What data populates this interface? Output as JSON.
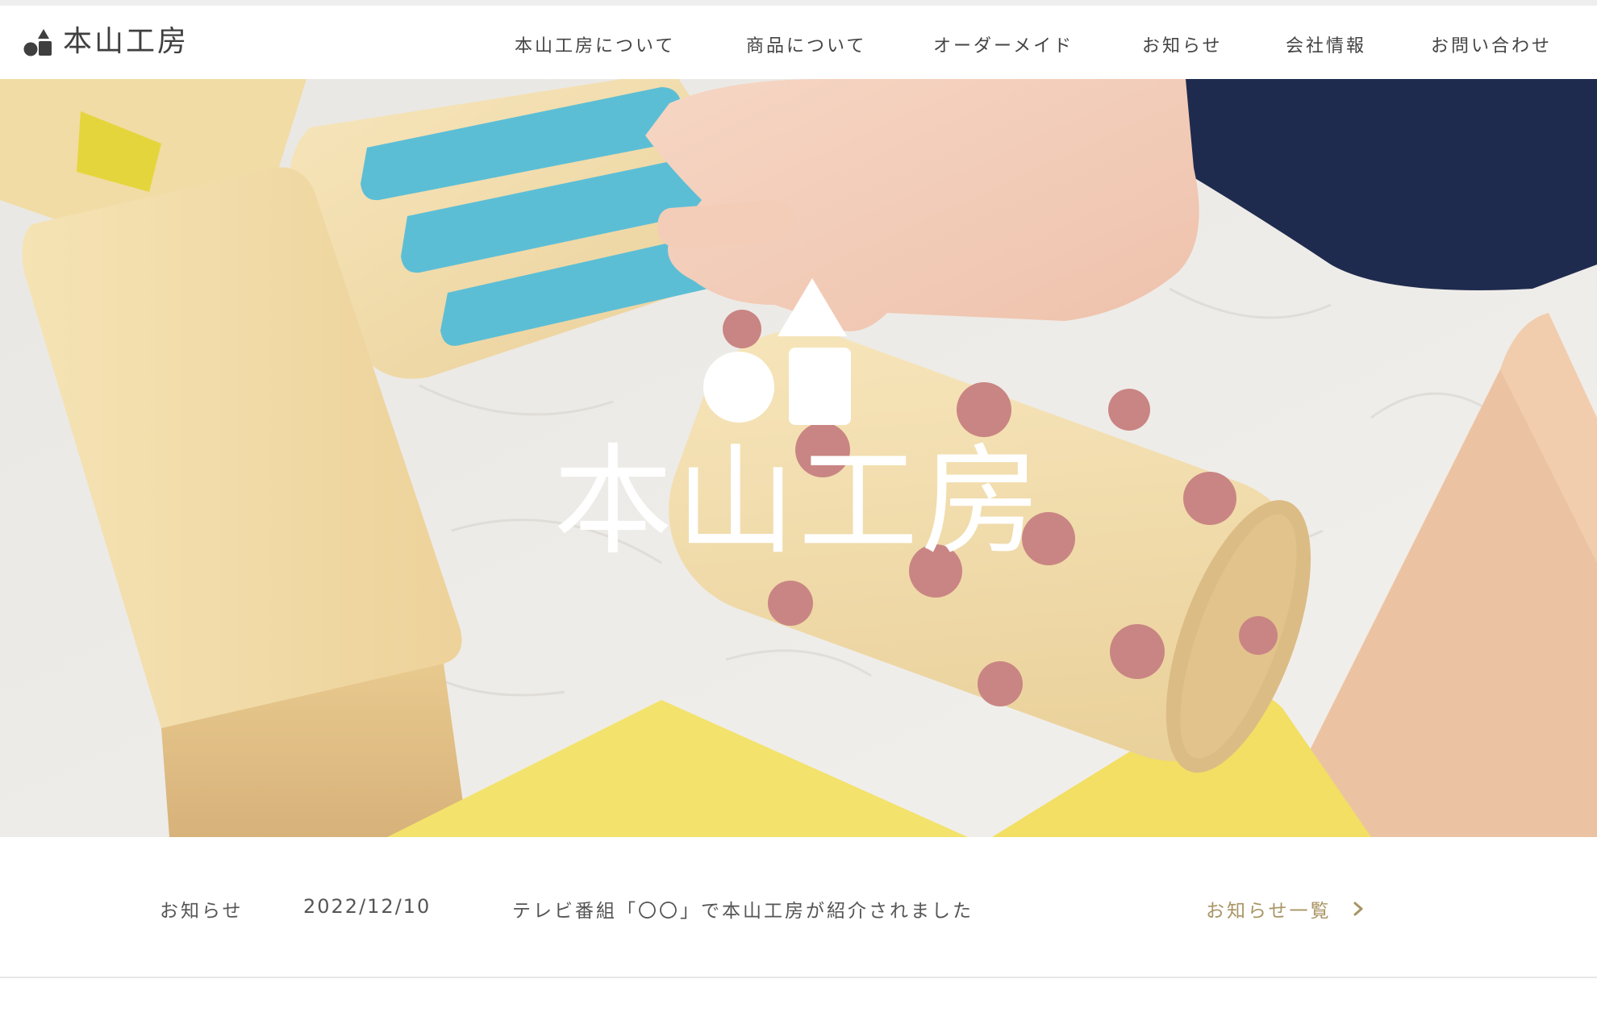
{
  "brand": {
    "name": "本山工房",
    "mark_color": "#3f3f3f"
  },
  "nav": {
    "items": [
      {
        "label": "本山工房について"
      },
      {
        "label": "商品について"
      },
      {
        "label": "オーダーメイド"
      },
      {
        "label": "お知らせ"
      },
      {
        "label": "会社情報"
      },
      {
        "label": "お問い合わせ"
      }
    ]
  },
  "hero": {
    "logo_text": "本山工房",
    "logo_color": "#ffffff"
  },
  "news": {
    "label": "お知らせ",
    "date": "2022/12/10",
    "title": "テレビ番組「〇〇」で本山工房が紹介されました",
    "more_label": "お知らせ一覧",
    "accent": "#a89464"
  },
  "icons": {
    "brand": "shapes-logo-icon",
    "more": "chevron-right-icon"
  }
}
